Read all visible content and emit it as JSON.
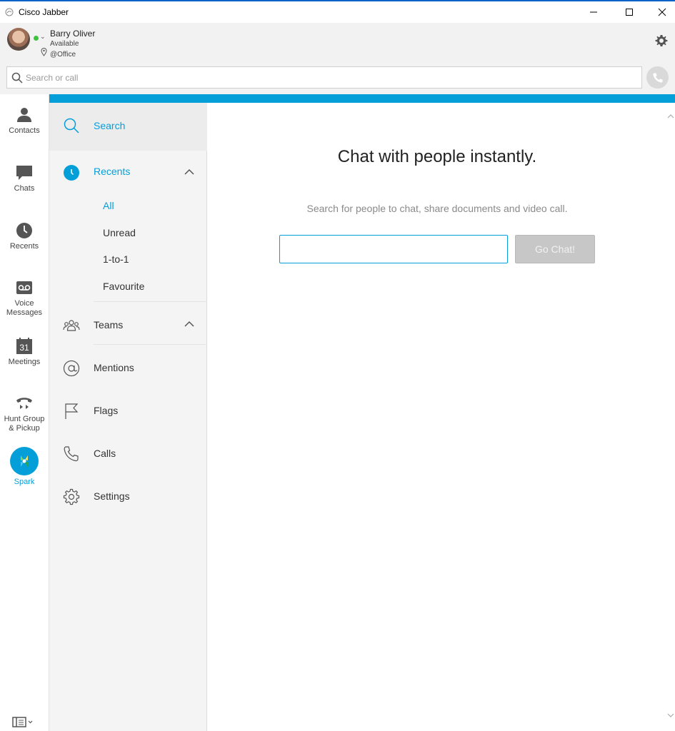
{
  "window": {
    "title": "Cisco Jabber"
  },
  "user": {
    "name": "Barry Oliver",
    "status": "Available",
    "location": "@Office",
    "presence_color": "#3ec33e"
  },
  "search": {
    "placeholder": "Search or call"
  },
  "rail": {
    "items": [
      {
        "label": "Contacts",
        "icon": "person-icon"
      },
      {
        "label": "Chats",
        "icon": "chat-bubble-icon"
      },
      {
        "label": "Recents",
        "icon": "clock-icon"
      },
      {
        "label_line1": "Voice",
        "label_line2": "Messages",
        "icon": "voicemail-icon"
      },
      {
        "label": "Meetings",
        "icon": "calendar-icon",
        "calendar_day": "31"
      },
      {
        "label_line1": "Hunt Group",
        "label_line2": "& Pickup",
        "icon": "phone-handset-icon"
      },
      {
        "label": "Spark",
        "icon": "spark-icon"
      }
    ]
  },
  "nav": {
    "search": "Search",
    "recents": "Recents",
    "recents_sub": [
      "All",
      "Unread",
      "1-to-1",
      "Favourite"
    ],
    "teams": "Teams",
    "mentions": "Mentions",
    "flags": "Flags",
    "calls": "Calls",
    "settings": "Settings"
  },
  "main": {
    "title": "Chat with people instantly.",
    "subtitle": "Search for people to chat, share documents and video call.",
    "input_value": "",
    "go_button": "Go Chat!"
  },
  "colors": {
    "accent": "#049fd9",
    "title_bar_border": "#0a64c8"
  }
}
